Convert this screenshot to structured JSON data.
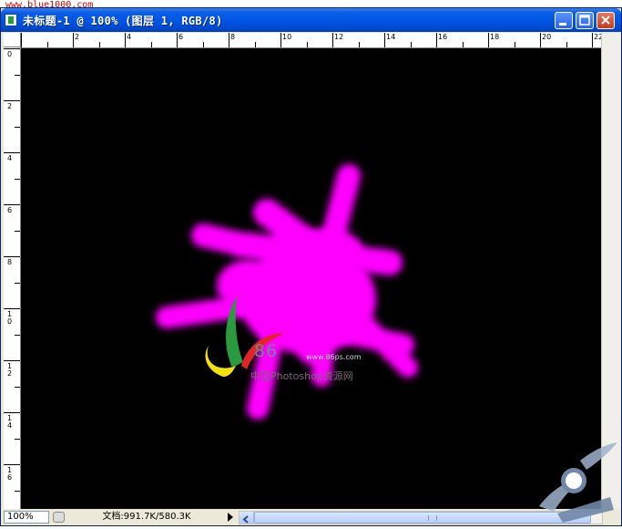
{
  "watermark": {
    "top_text": "www.blue1000.com"
  },
  "window": {
    "title": "未标题-1 @ 100% (图层 1, RGB/8)",
    "buttons": {
      "minimize": "minimize",
      "maximize": "maximize",
      "close": "close"
    }
  },
  "ruler": {
    "top_labels": [
      "2",
      "4",
      "6",
      "8",
      "10",
      "12",
      "14",
      "16",
      "18",
      "20",
      "22"
    ],
    "left_labels": [
      "0",
      "2",
      "4",
      "6",
      "8",
      "1\n0",
      "1\n2",
      "1\n4",
      "1\n6"
    ]
  },
  "canvas": {
    "background": "#000000",
    "brush_color": "#ff00ff",
    "logo_text": "86",
    "logo_url": "www.86ps.com",
    "logo_sub": "中国Photoshop资源网"
  },
  "status": {
    "zoom": "100%",
    "doc_info": "文档:991.7K/580.3K"
  },
  "colors": {
    "titlebar": "#0054e3",
    "frame": "#ece9d8",
    "magenta": "#ff00ff"
  }
}
